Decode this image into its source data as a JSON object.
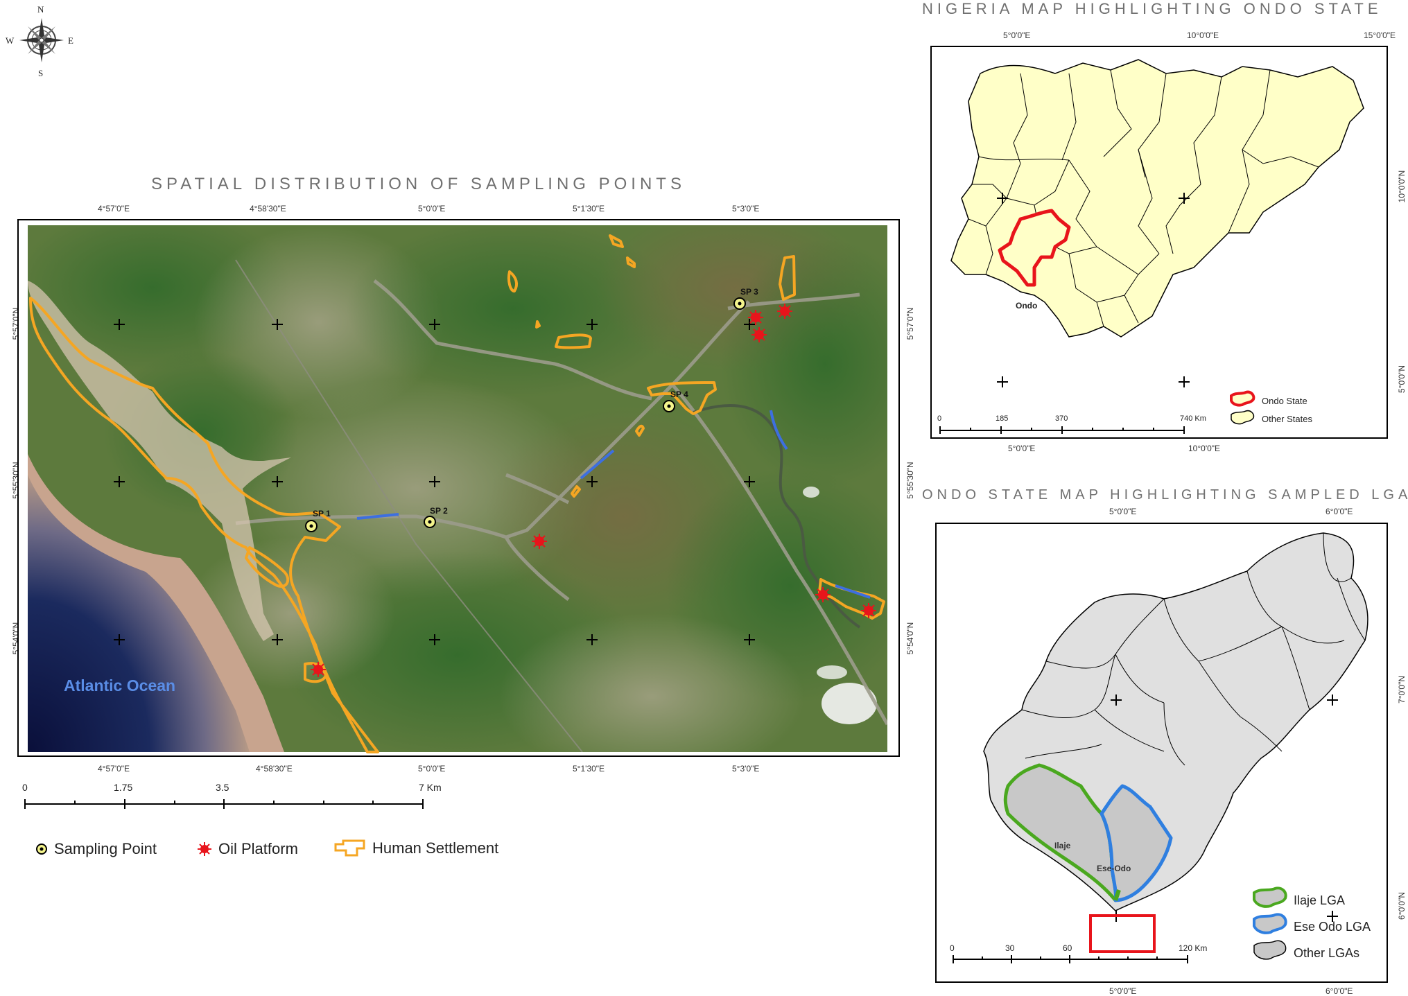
{
  "compass": {
    "north": "N",
    "south": "S",
    "east": "E",
    "west": "W"
  },
  "main_map": {
    "title": "SPATIAL DISTRIBUTION OF SAMPLING POINTS",
    "top_longitudes": [
      "4°57'0\"E",
      "4°58'30\"E",
      "5°0'0\"E",
      "5°1'30\"E",
      "5°3'0\"E"
    ],
    "bottom_longitudes": [
      "4°57'0\"E",
      "4°58'30\"E",
      "5°0'0\"E",
      "5°1'30\"E",
      "5°3'0\"E"
    ],
    "left_latitudes": [
      "5°57'0\"N",
      "5°55'30\"N",
      "5°54'0\"N"
    ],
    "right_latitudes": [
      "5°57'0\"N",
      "5°55'30\"N",
      "5°54'0\"N"
    ],
    "ocean_label": "Atlantic Ocean",
    "sampling_points": [
      {
        "label": "SP 1"
      },
      {
        "label": "SP 2"
      },
      {
        "label": "SP 3"
      },
      {
        "label": "SP 4"
      }
    ],
    "scale": {
      "ticks": [
        "0",
        "1.75",
        "3.5",
        "7 Km"
      ]
    },
    "legend": {
      "sampling_point": "Sampling Point",
      "oil_platform": "Oil Platform",
      "human_settlement": "Human Settlement"
    },
    "colors": {
      "settlement": "#f5a623",
      "oil_platform": "#e8141b",
      "sampling_point": "#f4f48c",
      "river": "#3d6fe0"
    }
  },
  "nigeria_map": {
    "title": "NIGERIA MAP HIGHLIGHTING ONDO STATE",
    "top_longitudes": [
      "5°0'0\"E",
      "10°0'0\"E",
      "15°0'0\"E"
    ],
    "bottom_longitudes": [
      "5°0'0\"E",
      "10°0'0\"E"
    ],
    "right_latitudes": [
      "10°0'0\"N",
      "5°0'0\"N"
    ],
    "state_label": "Ondo",
    "scale": {
      "ticks": [
        "0",
        "185",
        "370",
        "740 Km"
      ]
    },
    "legend": {
      "ondo_state": "Ondo State",
      "other_states": "Other States"
    },
    "colors": {
      "states_fill": "#ffffc8",
      "ondo_outline": "#e8141b"
    }
  },
  "ondo_map": {
    "title": "ONDO STATE MAP HIGHLIGHTING SAMPLED LGAs",
    "top_longitudes": [
      "5°0'0\"E",
      "6°0'0\"E"
    ],
    "bottom_longitudes": [
      "5°0'0\"E",
      "6°0'0\"E"
    ],
    "right_latitudes": [
      "7°0'0\"N",
      "6°0'0\"N"
    ],
    "ilaje_label": "Ilaje",
    "ese_odo_label": "Ese-Odo",
    "scale": {
      "ticks": [
        "0",
        "30",
        "60",
        "120 Km"
      ]
    },
    "legend": {
      "ilaje": "Ilaje LGA",
      "ese_odo": "Ese Odo LGA",
      "other": "Other LGAs"
    },
    "colors": {
      "lga_fill": "#e0e0e0",
      "ilaje": "#4aa81f",
      "ese_odo": "#2f7fe0",
      "study_box": "#e8141b"
    }
  }
}
